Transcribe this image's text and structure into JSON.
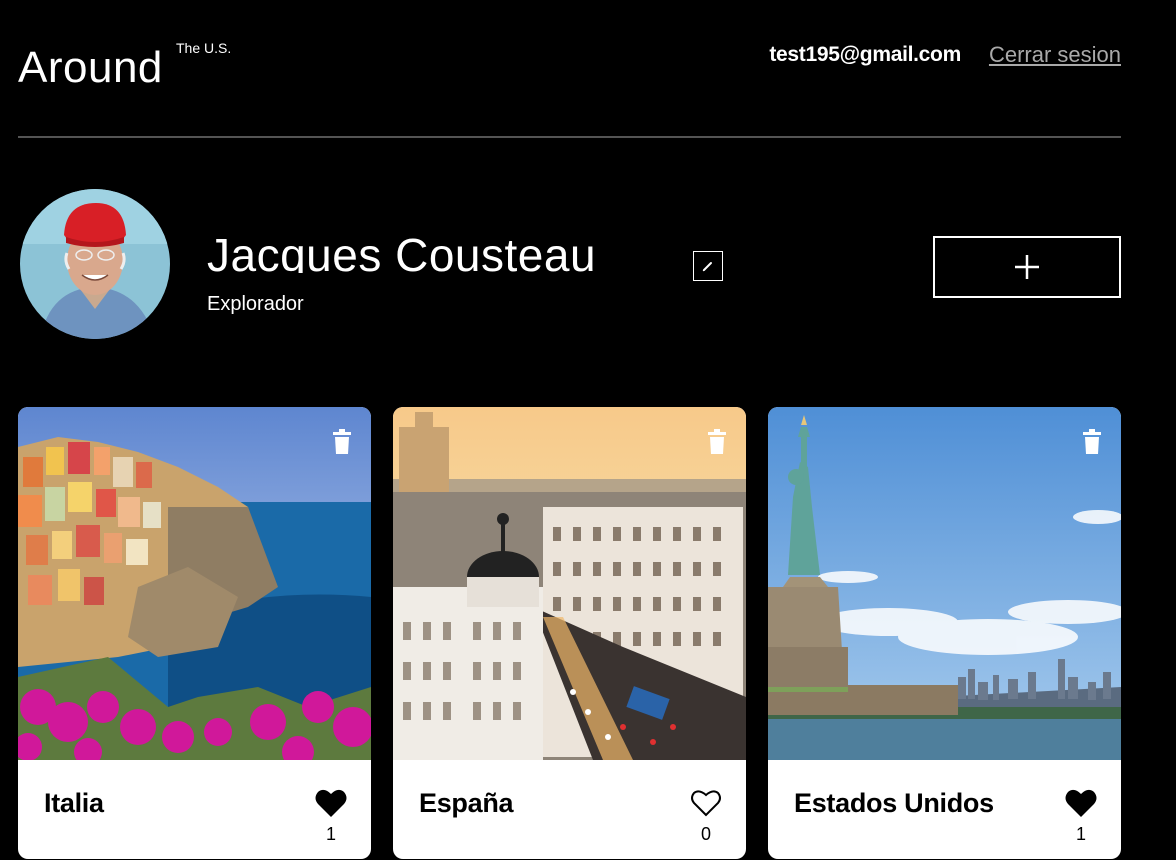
{
  "header": {
    "logo_text": "Around",
    "logo_sup": "The U.S.",
    "user_email": "test195@gmail.com",
    "logout_label": "Cerrar sesion"
  },
  "profile": {
    "name": "Jacques Cousteau",
    "about": "Explorador",
    "add_button_icon": "plus-icon",
    "edit_button_icon": "pencil-icon"
  },
  "cards": [
    {
      "title": "Italia",
      "likes": "1",
      "liked": true,
      "scene": "cinque-terre"
    },
    {
      "title": "España",
      "likes": "0",
      "liked": false,
      "scene": "madrid-gran-via"
    },
    {
      "title": "Estados Unidos",
      "likes": "1",
      "liked": true,
      "scene": "statue-of-liberty"
    }
  ],
  "colors": {
    "background": "#000000",
    "card_background": "#ffffff",
    "divider": "#545454",
    "logout_text": "#a9a9a9"
  }
}
